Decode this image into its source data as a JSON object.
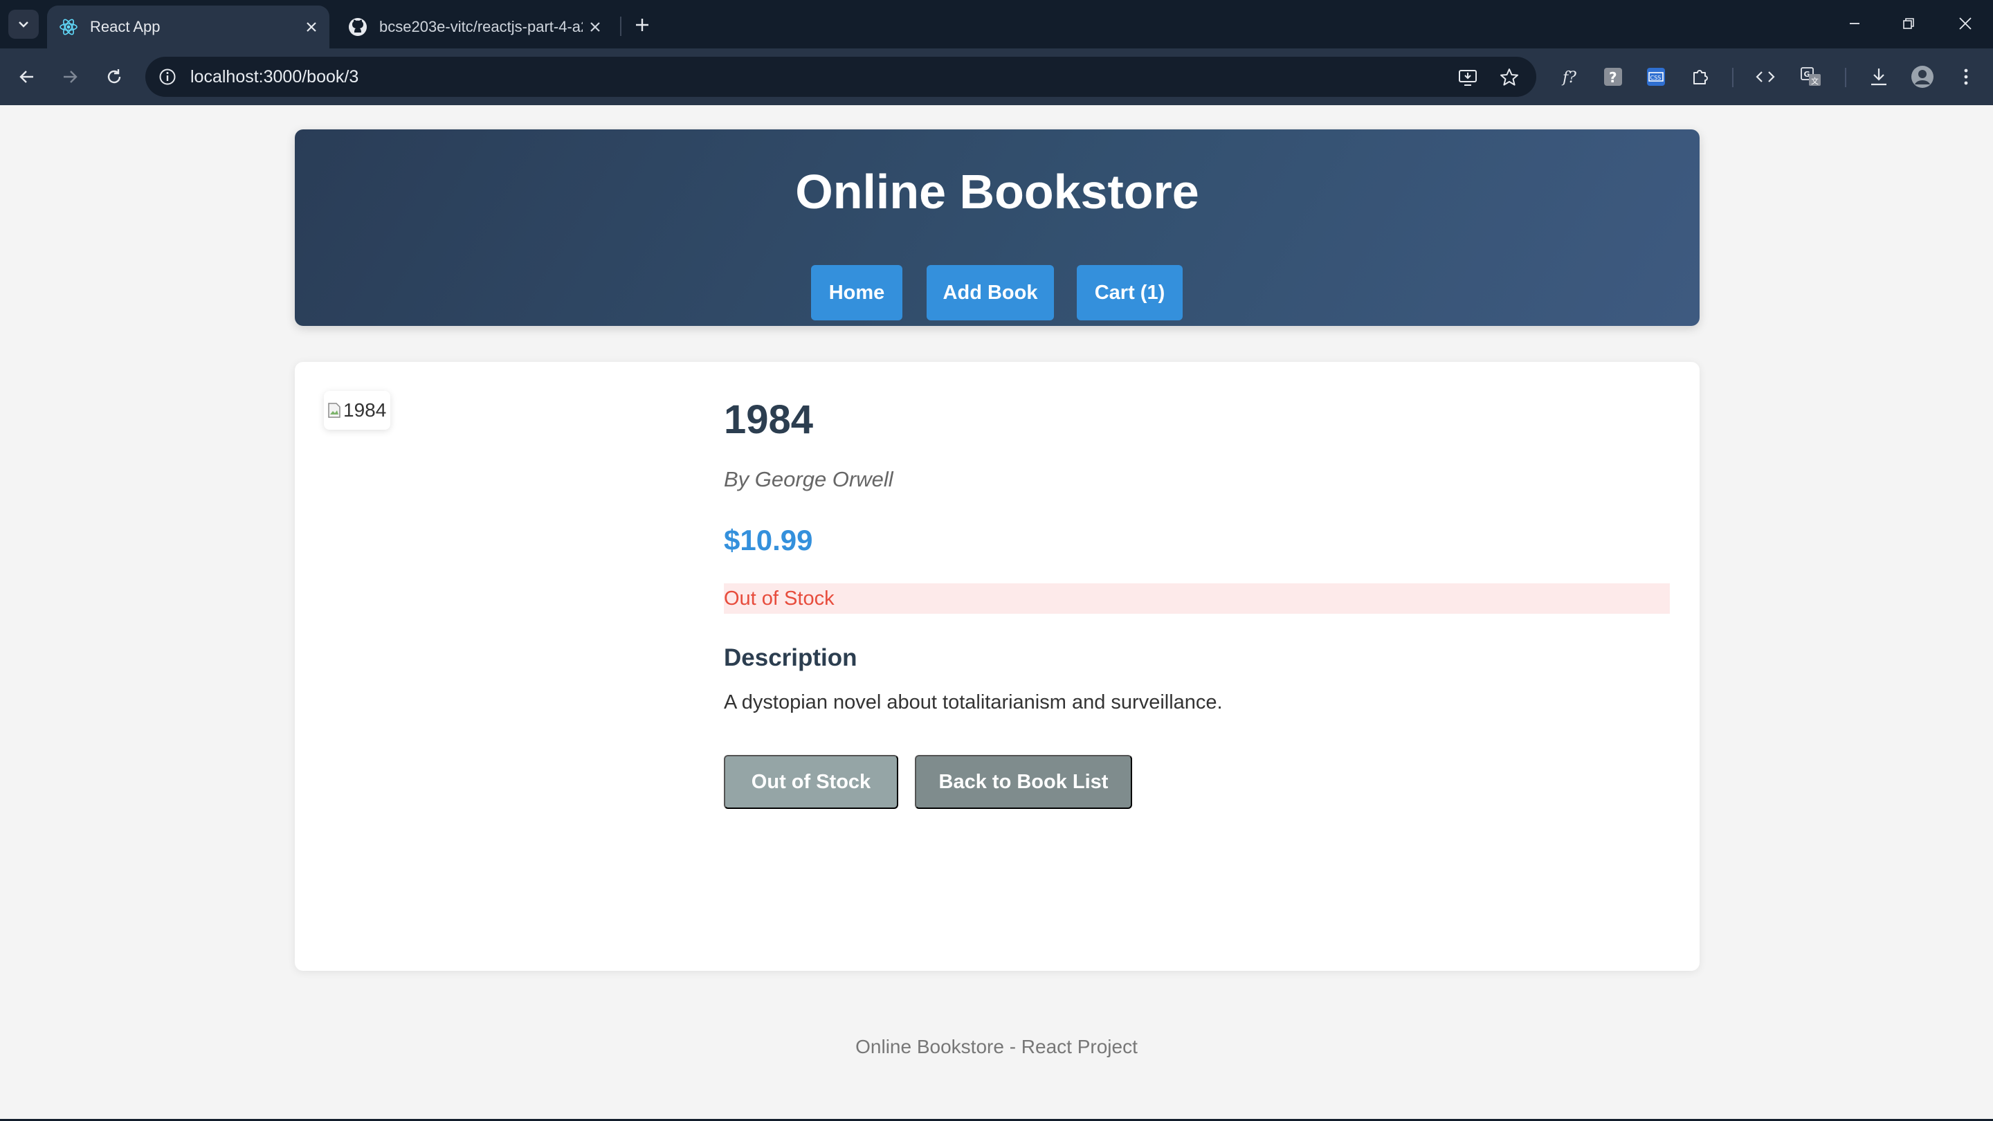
{
  "browser": {
    "tabs": [
      {
        "title": "React App",
        "icon": "react-icon",
        "active": true
      },
      {
        "title": "bcse203e-vitc/reactjs-part-4-a2",
        "icon": "github-icon",
        "active": false
      }
    ],
    "url": "localhost:3000/book/3"
  },
  "header": {
    "title": "Online Bookstore",
    "nav": {
      "home": "Home",
      "add_book": "Add Book",
      "cart": "Cart (1)"
    }
  },
  "book": {
    "image_alt": "1984",
    "title": "1984",
    "author": "By George Orwell",
    "price": "$10.99",
    "stock_status": "Out of Stock",
    "description_heading": "Description",
    "description": "A dystopian novel about totalitarianism and surveillance."
  },
  "actions": {
    "add_to_cart_disabled": "Out of Stock",
    "back": "Back to Book List"
  },
  "footer": {
    "text": "Online Bookstore - React Project"
  },
  "colors": {
    "primary": "#3490dc",
    "header_bg": "#33506f",
    "danger": "#e74c3c",
    "danger_bg": "#fdeaea",
    "disabled_button": "#95a5a6",
    "secondary_button": "#7f8c8d",
    "title_text": "#2c3e50"
  }
}
